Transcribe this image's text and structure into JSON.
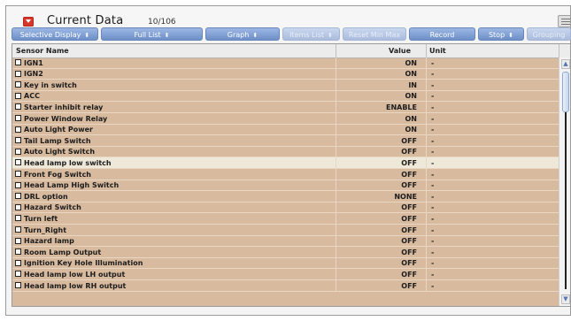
{
  "window": {
    "title": "Current Data",
    "count": "10/106"
  },
  "toolbar": {
    "buttons": [
      {
        "label": "Selective Display",
        "has_dropdown": true,
        "enabled": true
      },
      {
        "label": "Full List",
        "has_dropdown": true,
        "enabled": true
      },
      {
        "label": "Graph",
        "has_dropdown": true,
        "enabled": true
      },
      {
        "label": "Items List",
        "has_dropdown": true,
        "enabled": false
      },
      {
        "label": "Reset Min Max",
        "has_dropdown": false,
        "enabled": false
      },
      {
        "label": "Record",
        "has_dropdown": false,
        "enabled": true
      },
      {
        "label": "Stop",
        "has_dropdown": true,
        "enabled": true
      },
      {
        "label": "Grouping",
        "has_dropdown": false,
        "enabled": false
      }
    ]
  },
  "table": {
    "columns": {
      "name": "Sensor Name",
      "value": "Value",
      "unit": "Unit"
    },
    "rows": [
      {
        "name": "IGN1",
        "value": "ON",
        "unit": "-"
      },
      {
        "name": "IGN2",
        "value": "ON",
        "unit": "-"
      },
      {
        "name": "Key in switch",
        "value": "IN",
        "unit": "-"
      },
      {
        "name": "ACC",
        "value": "ON",
        "unit": "-"
      },
      {
        "name": "Starter inhibit relay",
        "value": "ENABLE",
        "unit": "-"
      },
      {
        "name": "Power Window Relay",
        "value": "ON",
        "unit": "-"
      },
      {
        "name": "Auto Light Power",
        "value": "ON",
        "unit": "-"
      },
      {
        "name": "Tail Lamp Switch",
        "value": "OFF",
        "unit": "-"
      },
      {
        "name": "Auto Light Switch",
        "value": "OFF",
        "unit": "-"
      },
      {
        "name": "Head lamp low switch",
        "value": "OFF",
        "unit": "-",
        "selected": true
      },
      {
        "name": "Front Fog Switch",
        "value": "OFF",
        "unit": "-"
      },
      {
        "name": "Head Lamp High Switch",
        "value": "OFF",
        "unit": "-"
      },
      {
        "name": "DRL option",
        "value": "NONE",
        "unit": "-"
      },
      {
        "name": "Hazard Switch",
        "value": "OFF",
        "unit": "-"
      },
      {
        "name": "Turn left",
        "value": "OFF",
        "unit": "-"
      },
      {
        "name": "Turn_Right",
        "value": "OFF",
        "unit": "-"
      },
      {
        "name": "Hazard lamp",
        "value": "OFF",
        "unit": "-"
      },
      {
        "name": "Room Lamp Output",
        "value": "OFF",
        "unit": "-"
      },
      {
        "name": "Ignition Key Hole Illumination",
        "value": "OFF",
        "unit": "-"
      },
      {
        "name": "Head lamp low LH output",
        "value": "OFF",
        "unit": "-"
      },
      {
        "name": "Head lamp low RH output",
        "value": "OFF",
        "unit": "-"
      }
    ]
  },
  "colors": {
    "row_bg": "#d8ba9f",
    "row_selected_bg": "#eee8d9",
    "button_bg": "#7f9fd4",
    "title_icon": "#d8382a"
  },
  "icons": {
    "title": "collapse-icon",
    "corner": "menu-icon",
    "scroll_up": "scroll-up-icon",
    "scroll_down": "scroll-down-icon"
  }
}
